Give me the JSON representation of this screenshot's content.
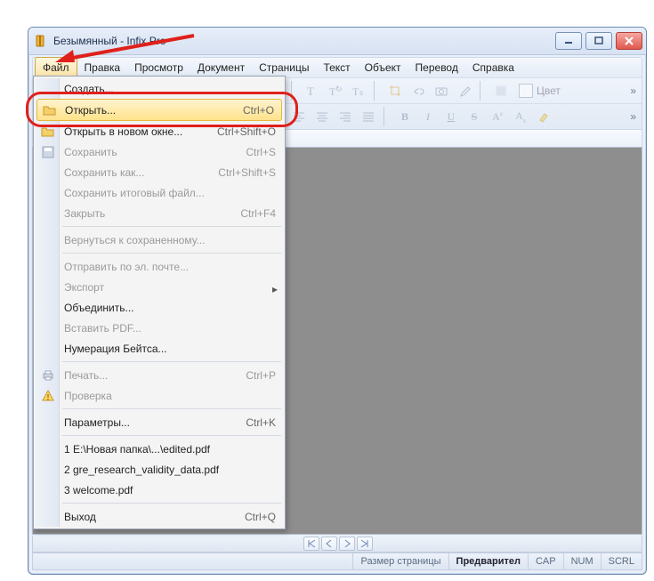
{
  "window": {
    "title": "Безымянный - Infix Pro"
  },
  "menubar": [
    "Файл",
    "Правка",
    "Просмотр",
    "Документ",
    "Страницы",
    "Текст",
    "Объект",
    "Перевод",
    "Справка"
  ],
  "filemenu": {
    "items": [
      {
        "kind": "item",
        "icon": "",
        "label": "Создать...",
        "shortcut": "",
        "enabled": true
      },
      {
        "kind": "item",
        "icon": "open",
        "label": "Открыть...",
        "shortcut": "Ctrl+O",
        "enabled": true,
        "highlight": true
      },
      {
        "kind": "item",
        "icon": "open",
        "label": "Открыть в новом окне...",
        "shortcut": "Ctrl+Shift+O",
        "enabled": true
      },
      {
        "kind": "item",
        "icon": "save",
        "label": "Сохранить",
        "shortcut": "Ctrl+S",
        "enabled": false
      },
      {
        "kind": "item",
        "icon": "",
        "label": "Сохранить как...",
        "shortcut": "Ctrl+Shift+S",
        "enabled": false
      },
      {
        "kind": "item",
        "icon": "",
        "label": "Сохранить итоговый файл...",
        "shortcut": "",
        "enabled": false
      },
      {
        "kind": "item",
        "icon": "",
        "label": "Закрыть",
        "shortcut": "Ctrl+F4",
        "enabled": false
      },
      {
        "kind": "sep"
      },
      {
        "kind": "item",
        "icon": "",
        "label": "Вернуться к сохраненному...",
        "shortcut": "",
        "enabled": false
      },
      {
        "kind": "sep"
      },
      {
        "kind": "item",
        "icon": "",
        "label": "Отправить по эл. почте...",
        "shortcut": "",
        "enabled": false
      },
      {
        "kind": "sub",
        "icon": "",
        "label": "Экспорт",
        "enabled": false
      },
      {
        "kind": "item",
        "icon": "",
        "label": "Объединить...",
        "shortcut": "",
        "enabled": true
      },
      {
        "kind": "item",
        "icon": "",
        "label": "Вставить PDF...",
        "shortcut": "",
        "enabled": false
      },
      {
        "kind": "item",
        "icon": "",
        "label": "Нумерация Бейтса...",
        "shortcut": "",
        "enabled": true
      },
      {
        "kind": "sep"
      },
      {
        "kind": "item",
        "icon": "print",
        "label": "Печать...",
        "shortcut": "Ctrl+P",
        "enabled": false
      },
      {
        "kind": "item",
        "icon": "warn",
        "label": "Проверка",
        "shortcut": "",
        "enabled": false
      },
      {
        "kind": "sep"
      },
      {
        "kind": "item",
        "icon": "",
        "label": "Параметры...",
        "shortcut": "Ctrl+K",
        "enabled": true
      },
      {
        "kind": "sep"
      },
      {
        "kind": "item",
        "icon": "",
        "label": "1 E:\\Новая папка\\...\\edited.pdf",
        "shortcut": "",
        "enabled": true
      },
      {
        "kind": "item",
        "icon": "",
        "label": "2 gre_research_validity_data.pdf",
        "shortcut": "",
        "enabled": true
      },
      {
        "kind": "item",
        "icon": "",
        "label": "3 welcome.pdf",
        "shortcut": "",
        "enabled": true
      },
      {
        "kind": "sep"
      },
      {
        "kind": "item",
        "icon": "",
        "label": "Выход",
        "shortcut": "Ctrl+Q",
        "enabled": true
      }
    ]
  },
  "toolbar_labels": {
    "color": "Цвет"
  },
  "statusbar": {
    "page_size_label": "Размер страницы",
    "preview_label": "Предварител",
    "cap": "CAP",
    "num": "NUM",
    "scrl": "SCRL"
  }
}
